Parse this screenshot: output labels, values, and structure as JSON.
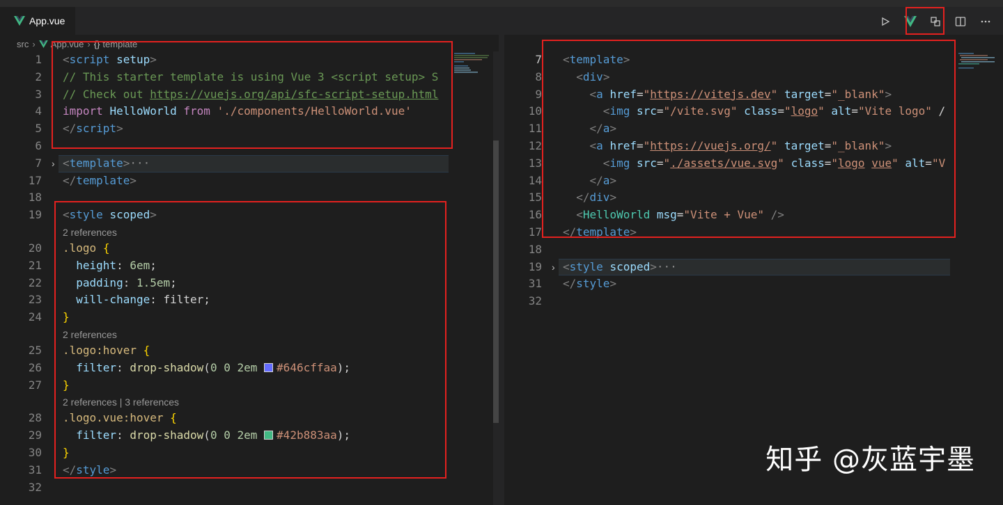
{
  "tab": {
    "label": "App.vue"
  },
  "breadcrumb": {
    "src": "src",
    "file": "App.vue",
    "symbol_glyph": "{}",
    "symbol": "template"
  },
  "watermark": "知乎 @灰蓝宇墨",
  "left_lines": [
    {
      "n": "1",
      "segs": [
        [
          "t-tag",
          "<"
        ],
        [
          "t-name",
          "script"
        ],
        [
          "t-txt",
          " "
        ],
        [
          "t-attr",
          "setup"
        ],
        [
          "t-tag",
          ">"
        ]
      ]
    },
    {
      "n": "2",
      "segs": [
        [
          "t-com",
          "// This starter template is using Vue 3 <script setup> S"
        ]
      ]
    },
    {
      "n": "3",
      "segs": [
        [
          "t-com",
          "// Check out "
        ],
        [
          "t-link",
          "https://vuejs.org/api/sfc-script-setup.html"
        ]
      ]
    },
    {
      "n": "4",
      "segs": [
        [
          "t-kw",
          "import"
        ],
        [
          "t-txt",
          " "
        ],
        [
          "t-var",
          "HelloWorld"
        ],
        [
          "t-txt",
          " "
        ],
        [
          "t-kw",
          "from"
        ],
        [
          "t-txt",
          " "
        ],
        [
          "t-str",
          "'./components/HelloWorld.vue'"
        ]
      ]
    },
    {
      "n": "5",
      "segs": [
        [
          "t-tag",
          "</"
        ],
        [
          "t-name",
          "script"
        ],
        [
          "t-tag",
          ">"
        ]
      ]
    },
    {
      "n": "6",
      "segs": []
    },
    {
      "n": "7",
      "segs": [
        [
          "t-tag",
          "<"
        ],
        [
          "t-name",
          "template"
        ],
        [
          "t-tag",
          ">"
        ],
        [
          "t-dots",
          "···"
        ]
      ],
      "fold": true,
      "highlight": true
    },
    {
      "n": "17",
      "segs": [
        [
          "t-tag",
          "</"
        ],
        [
          "t-name",
          "template"
        ],
        [
          "t-tag",
          ">"
        ]
      ]
    },
    {
      "n": "18",
      "segs": []
    },
    {
      "n": "19",
      "segs": [
        [
          "t-tag",
          "<"
        ],
        [
          "t-name",
          "style"
        ],
        [
          "t-txt",
          " "
        ],
        [
          "t-attr",
          "scoped"
        ],
        [
          "t-tag",
          ">"
        ]
      ]
    },
    {
      "lens": "2 references"
    },
    {
      "n": "20",
      "segs": [
        [
          "t-sel",
          ".logo"
        ],
        [
          "t-txt",
          " "
        ],
        [
          "t-brace",
          "{"
        ]
      ]
    },
    {
      "n": "21",
      "segs": [
        [
          "t-txt",
          "  "
        ],
        [
          "t-prop",
          "height"
        ],
        [
          "t-txt",
          ": "
        ],
        [
          "t-num",
          "6em"
        ],
        [
          "t-txt",
          ";"
        ]
      ]
    },
    {
      "n": "22",
      "segs": [
        [
          "t-txt",
          "  "
        ],
        [
          "t-prop",
          "padding"
        ],
        [
          "t-txt",
          ": "
        ],
        [
          "t-num",
          "1.5em"
        ],
        [
          "t-txt",
          ";"
        ]
      ]
    },
    {
      "n": "23",
      "segs": [
        [
          "t-txt",
          "  "
        ],
        [
          "t-prop",
          "will-change"
        ],
        [
          "t-txt",
          ": filter;"
        ]
      ]
    },
    {
      "n": "24",
      "segs": [
        [
          "t-brace",
          "}"
        ]
      ]
    },
    {
      "lens": "2 references"
    },
    {
      "n": "25",
      "segs": [
        [
          "t-sel",
          ".logo:hover"
        ],
        [
          "t-txt",
          " "
        ],
        [
          "t-brace",
          "{"
        ]
      ]
    },
    {
      "n": "26",
      "segs": [
        [
          "t-txt",
          "  "
        ],
        [
          "t-prop",
          "filter"
        ],
        [
          "t-txt",
          ": "
        ],
        [
          "t-fn",
          "drop-shadow"
        ],
        [
          "t-txt",
          "("
        ],
        [
          "t-num",
          "0"
        ],
        [
          "t-txt",
          " "
        ],
        [
          "t-num",
          "0"
        ],
        [
          "t-txt",
          " "
        ],
        [
          "t-num",
          "2em"
        ],
        [
          "t-txt",
          " "
        ],
        [
          "swatch",
          "#646cff"
        ],
        [
          "t-str",
          "#646cffaa"
        ],
        [
          "t-txt",
          ");"
        ]
      ]
    },
    {
      "n": "27",
      "segs": [
        [
          "t-brace",
          "}"
        ]
      ]
    },
    {
      "lens": "2 references | 3 references"
    },
    {
      "n": "28",
      "segs": [
        [
          "t-sel",
          ".logo.vue:hover"
        ],
        [
          "t-txt",
          " "
        ],
        [
          "t-brace",
          "{"
        ]
      ]
    },
    {
      "n": "29",
      "segs": [
        [
          "t-txt",
          "  "
        ],
        [
          "t-prop",
          "filter"
        ],
        [
          "t-txt",
          ": "
        ],
        [
          "t-fn",
          "drop-shadow"
        ],
        [
          "t-txt",
          "("
        ],
        [
          "t-num",
          "0"
        ],
        [
          "t-txt",
          " "
        ],
        [
          "t-num",
          "0"
        ],
        [
          "t-txt",
          " "
        ],
        [
          "t-num",
          "2em"
        ],
        [
          "t-txt",
          " "
        ],
        [
          "swatch",
          "#42b883"
        ],
        [
          "t-str",
          "#42b883aa"
        ],
        [
          "t-txt",
          ");"
        ]
      ]
    },
    {
      "n": "30",
      "segs": [
        [
          "t-brace",
          "}"
        ]
      ]
    },
    {
      "n": "31",
      "segs": [
        [
          "t-tag",
          "</"
        ],
        [
          "t-name",
          "style"
        ],
        [
          "t-tag",
          ">"
        ]
      ]
    },
    {
      "n": "32",
      "segs": []
    }
  ],
  "right_lines": [
    {
      "n": "7",
      "active": true,
      "segs": [
        [
          "t-tag",
          "<"
        ],
        [
          "t-name",
          "template"
        ],
        [
          "t-tag",
          ">"
        ]
      ]
    },
    {
      "n": "8",
      "segs": [
        [
          "t-txt",
          "  "
        ],
        [
          "t-tag",
          "<"
        ],
        [
          "t-name",
          "div"
        ],
        [
          "t-tag",
          ">"
        ]
      ]
    },
    {
      "n": "9",
      "segs": [
        [
          "t-txt",
          "    "
        ],
        [
          "t-tag",
          "<"
        ],
        [
          "t-name",
          "a"
        ],
        [
          "t-txt",
          " "
        ],
        [
          "t-attr",
          "href"
        ],
        [
          "t-txt",
          "="
        ],
        [
          "t-str",
          "\""
        ],
        [
          "t-strlink",
          "https://vitejs.dev"
        ],
        [
          "t-str",
          "\""
        ],
        [
          "t-txt",
          " "
        ],
        [
          "t-attr",
          "target"
        ],
        [
          "t-txt",
          "="
        ],
        [
          "t-str",
          "\"_blank\""
        ],
        [
          "t-tag",
          ">"
        ]
      ]
    },
    {
      "n": "10",
      "segs": [
        [
          "t-txt",
          "      "
        ],
        [
          "t-tag",
          "<"
        ],
        [
          "t-name",
          "img"
        ],
        [
          "t-txt",
          " "
        ],
        [
          "t-attr",
          "src"
        ],
        [
          "t-txt",
          "="
        ],
        [
          "t-str",
          "\"/vite.svg\""
        ],
        [
          "t-txt",
          " "
        ],
        [
          "t-attr",
          "class"
        ],
        [
          "t-txt",
          "="
        ],
        [
          "t-str",
          "\""
        ],
        [
          "t-strlink",
          "logo"
        ],
        [
          "t-str",
          "\""
        ],
        [
          "t-txt",
          " "
        ],
        [
          "t-attr",
          "alt"
        ],
        [
          "t-txt",
          "="
        ],
        [
          "t-str",
          "\"Vite logo\""
        ],
        [
          "t-txt",
          " /"
        ]
      ]
    },
    {
      "n": "11",
      "segs": [
        [
          "t-txt",
          "    "
        ],
        [
          "t-tag",
          "</"
        ],
        [
          "t-name",
          "a"
        ],
        [
          "t-tag",
          ">"
        ]
      ]
    },
    {
      "n": "12",
      "segs": [
        [
          "t-txt",
          "    "
        ],
        [
          "t-tag",
          "<"
        ],
        [
          "t-name",
          "a"
        ],
        [
          "t-txt",
          " "
        ],
        [
          "t-attr",
          "href"
        ],
        [
          "t-txt",
          "="
        ],
        [
          "t-str",
          "\""
        ],
        [
          "t-strlink",
          "https://vuejs.org/"
        ],
        [
          "t-str",
          "\""
        ],
        [
          "t-txt",
          " "
        ],
        [
          "t-attr",
          "target"
        ],
        [
          "t-txt",
          "="
        ],
        [
          "t-str",
          "\"_blank\""
        ],
        [
          "t-tag",
          ">"
        ]
      ]
    },
    {
      "n": "13",
      "segs": [
        [
          "t-txt",
          "      "
        ],
        [
          "t-tag",
          "<"
        ],
        [
          "t-name",
          "img"
        ],
        [
          "t-txt",
          " "
        ],
        [
          "t-attr",
          "src"
        ],
        [
          "t-txt",
          "="
        ],
        [
          "t-str",
          "\""
        ],
        [
          "t-strlink",
          "./assets/vue.svg"
        ],
        [
          "t-str",
          "\""
        ],
        [
          "t-txt",
          " "
        ],
        [
          "t-attr",
          "class"
        ],
        [
          "t-txt",
          "="
        ],
        [
          "t-str",
          "\""
        ],
        [
          "t-strlink",
          "logo"
        ],
        [
          "t-str",
          " "
        ],
        [
          "t-strlink",
          "vue"
        ],
        [
          "t-str",
          "\""
        ],
        [
          "t-txt",
          " "
        ],
        [
          "t-attr",
          "alt"
        ],
        [
          "t-txt",
          "="
        ],
        [
          "t-str",
          "\"V"
        ]
      ]
    },
    {
      "n": "14",
      "segs": [
        [
          "t-txt",
          "    "
        ],
        [
          "t-tag",
          "</"
        ],
        [
          "t-name",
          "a"
        ],
        [
          "t-tag",
          ">"
        ]
      ]
    },
    {
      "n": "15",
      "segs": [
        [
          "t-txt",
          "  "
        ],
        [
          "t-tag",
          "</"
        ],
        [
          "t-name",
          "div"
        ],
        [
          "t-tag",
          ">"
        ]
      ]
    },
    {
      "n": "16",
      "segs": [
        [
          "t-txt",
          "  "
        ],
        [
          "t-tag",
          "<"
        ],
        [
          "t-comp",
          "HelloWorld"
        ],
        [
          "t-txt",
          " "
        ],
        [
          "t-attr",
          "msg"
        ],
        [
          "t-txt",
          "="
        ],
        [
          "t-str",
          "\"Vite + Vue\""
        ],
        [
          "t-txt",
          " "
        ],
        [
          "t-tag",
          "/>"
        ]
      ]
    },
    {
      "n": "17",
      "segs": [
        [
          "t-tag",
          "</"
        ],
        [
          "t-name",
          "template"
        ],
        [
          "t-tag",
          ">"
        ]
      ]
    },
    {
      "n": "18",
      "segs": []
    },
    {
      "n": "19",
      "segs": [
        [
          "t-tag",
          "<"
        ],
        [
          "t-name",
          "style"
        ],
        [
          "t-txt",
          " "
        ],
        [
          "t-attr",
          "scoped"
        ],
        [
          "t-tag",
          ">"
        ],
        [
          "t-dots",
          "···"
        ]
      ],
      "fold": true,
      "highlight": true
    },
    {
      "n": "31",
      "segs": [
        [
          "t-tag",
          "</"
        ],
        [
          "t-name",
          "style"
        ],
        [
          "t-tag",
          ">"
        ]
      ]
    },
    {
      "n": "32",
      "segs": []
    }
  ]
}
